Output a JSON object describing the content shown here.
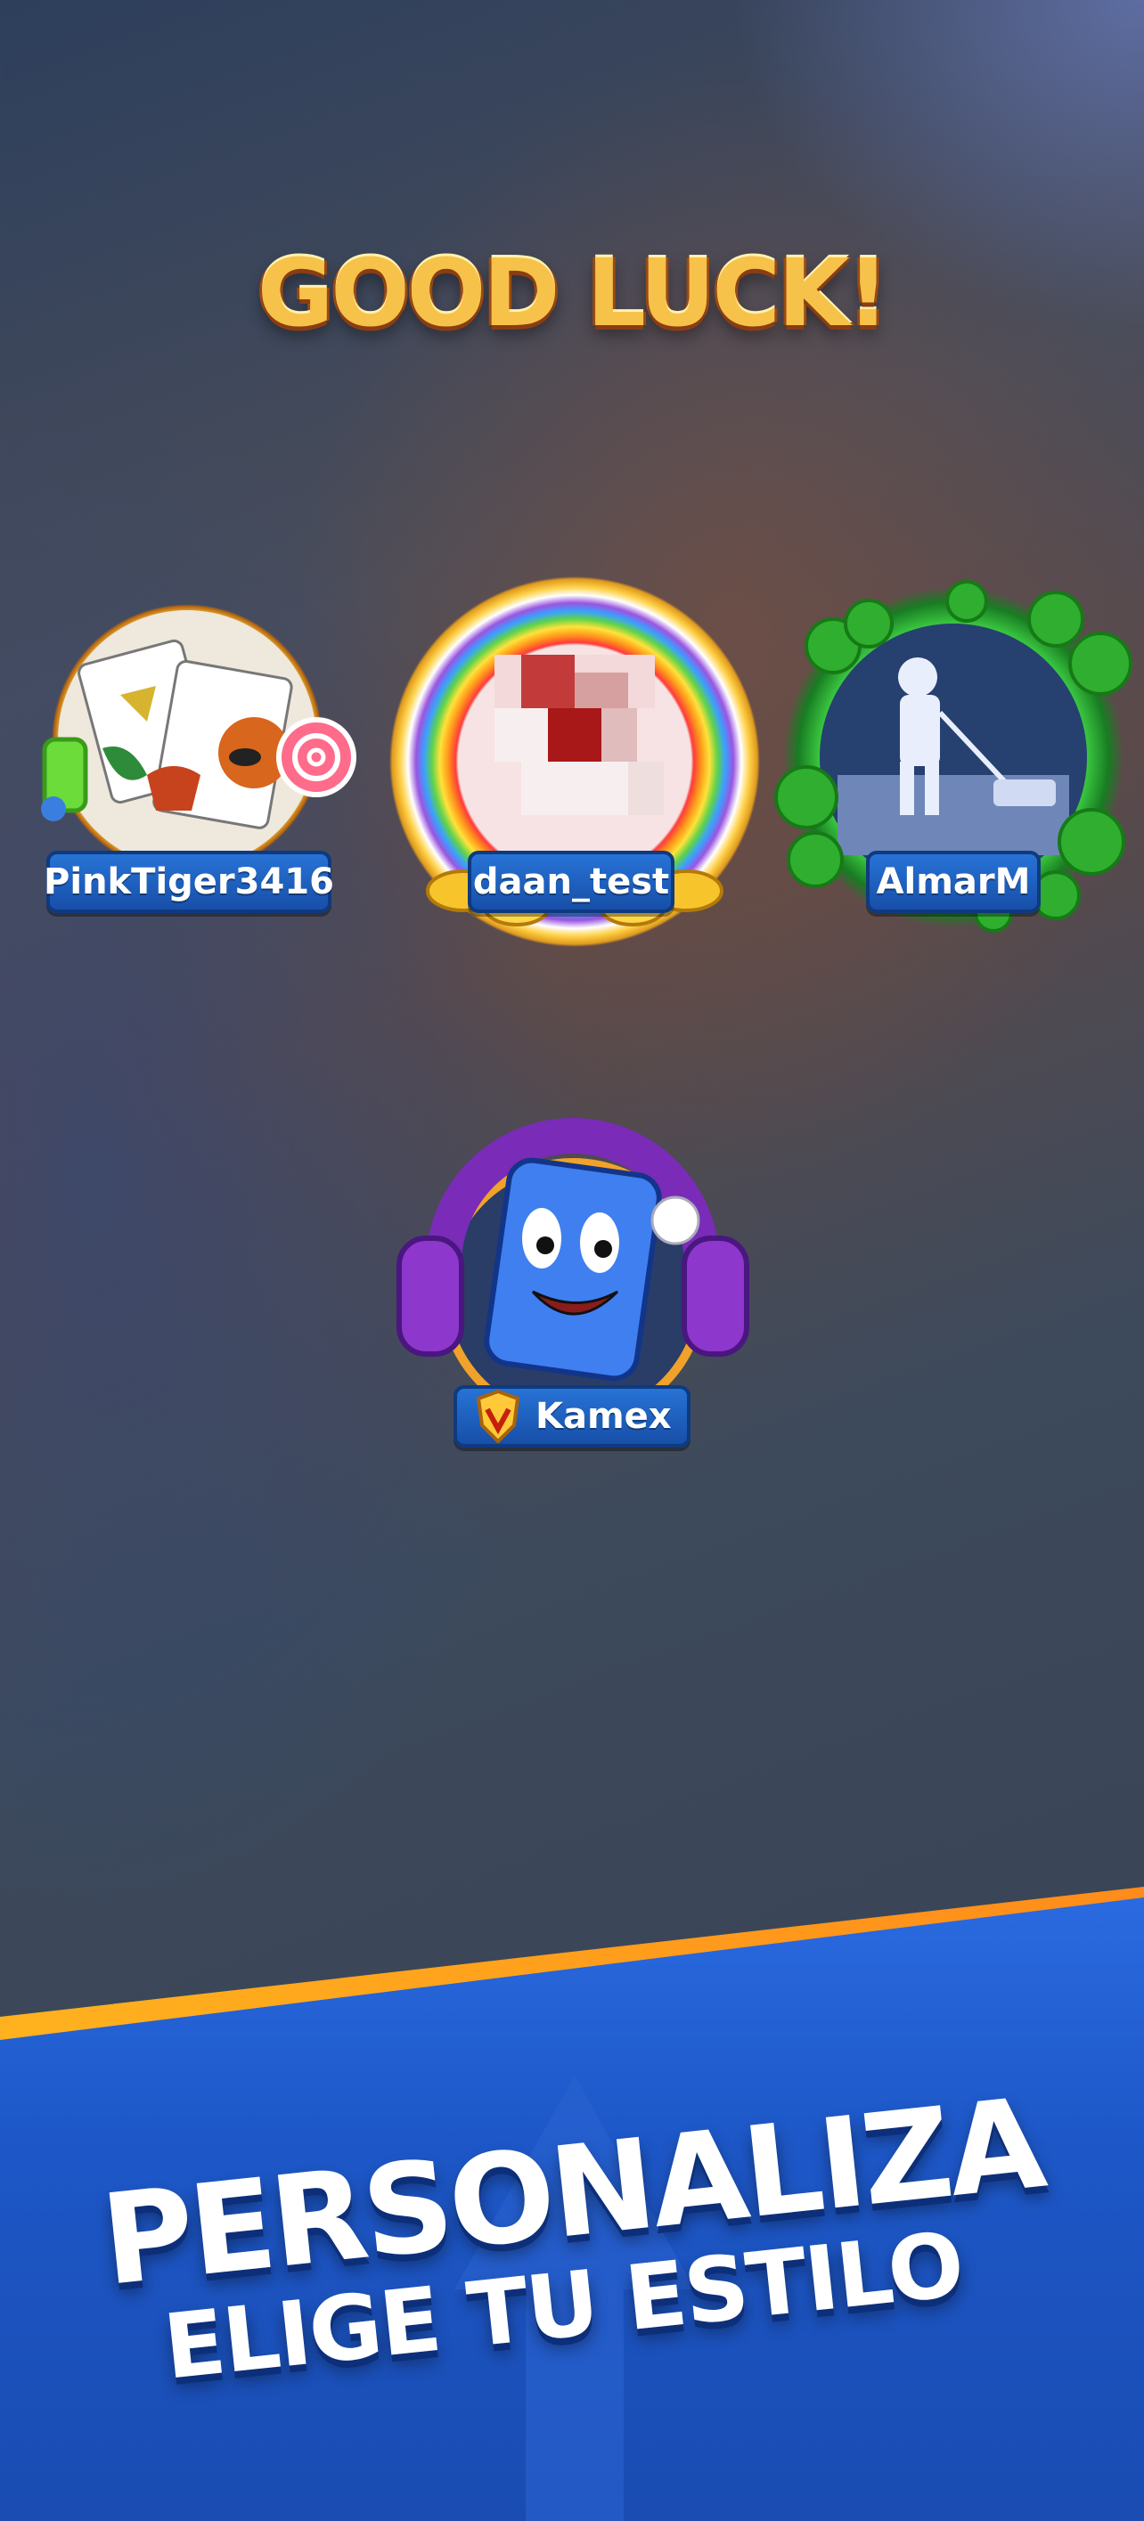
{
  "header": {
    "title": "GOOD LUCK!"
  },
  "players": [
    {
      "name": "PinkTiger3416"
    },
    {
      "name": "daan_test"
    },
    {
      "name": "AlmarM"
    },
    {
      "name": "Kamex"
    }
  ],
  "promo": {
    "line1": "PERSONALIZA",
    "line2": "ELIGE TU ESTILO"
  },
  "colors": {
    "title_gold": "#f6c24a",
    "nametag_blue": "#2773d6",
    "band_blue": "#1d57c7",
    "stripe_orange": "#ffa21e"
  }
}
